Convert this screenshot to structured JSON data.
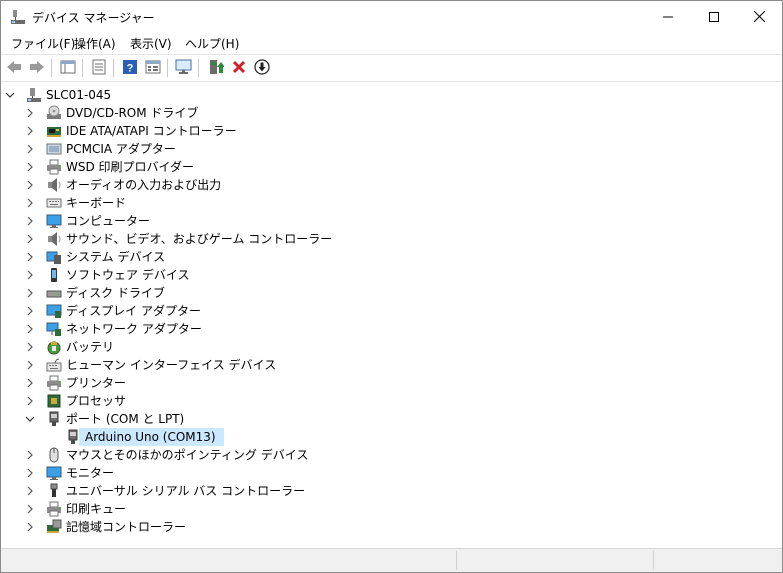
{
  "window": {
    "title": "デバイス マネージャー"
  },
  "menu": {
    "items": [
      "ファイル(F)",
      "操作(A)",
      "表示(V)",
      "ヘルプ(H)"
    ]
  },
  "toolbar": {
    "buttons": [
      "back-icon",
      "forward-icon",
      "show-hide-tree-icon",
      "properties-icon",
      "help-icon",
      "view-icon",
      "scan-hardware-icon",
      "update-driver-icon",
      "uninstall-icon",
      "disable-icon"
    ]
  },
  "tree": {
    "root": "SLC01-045",
    "categories": [
      {
        "label": "DVD/CD-ROM ドライブ",
        "icon": "dvd-drive-icon"
      },
      {
        "label": "IDE ATA/ATAPI コントローラー",
        "icon": "ide-controller-icon"
      },
      {
        "label": "PCMCIA アダプター",
        "icon": "pcmcia-icon"
      },
      {
        "label": "WSD 印刷プロバイダー",
        "icon": "printer-icon"
      },
      {
        "label": "オーディオの入力および出力",
        "icon": "speaker-icon"
      },
      {
        "label": "キーボード",
        "icon": "keyboard-icon"
      },
      {
        "label": "コンピューター",
        "icon": "computer-icon"
      },
      {
        "label": "サウンド、ビデオ、およびゲーム コントローラー",
        "icon": "speaker-icon"
      },
      {
        "label": "システム デバイス",
        "icon": "system-device-icon"
      },
      {
        "label": "ソフトウェア デバイス",
        "icon": "software-device-icon"
      },
      {
        "label": "ディスク ドライブ",
        "icon": "disk-drive-icon"
      },
      {
        "label": "ディスプレイ アダプター",
        "icon": "display-adapter-icon"
      },
      {
        "label": "ネットワーク アダプター",
        "icon": "network-adapter-icon"
      },
      {
        "label": "バッテリ",
        "icon": "battery-icon"
      },
      {
        "label": "ヒューマン インターフェイス デバイス",
        "icon": "hid-icon"
      },
      {
        "label": "プリンター",
        "icon": "printer-icon"
      },
      {
        "label": "プロセッサ",
        "icon": "processor-icon"
      },
      {
        "label": "ポート (COM と LPT)",
        "icon": "port-icon",
        "expanded": true
      },
      {
        "label": "マウスとそのほかのポインティング デバイス",
        "icon": "mouse-icon"
      },
      {
        "label": "モニター",
        "icon": "monitor-icon"
      },
      {
        "label": "ユニバーサル シリアル バス コントローラー",
        "icon": "usb-icon"
      },
      {
        "label": "印刷キュー",
        "icon": "printer-icon"
      },
      {
        "label": "記憶域コントローラー",
        "icon": "storage-controller-icon"
      }
    ],
    "selected_child": {
      "label": "Arduino Uno (COM13)",
      "icon": "port-icon"
    }
  },
  "colors": {
    "selection": "#cce8ff",
    "status_bar": "#f0f0f0",
    "uninstall_red": "#d1202a"
  }
}
